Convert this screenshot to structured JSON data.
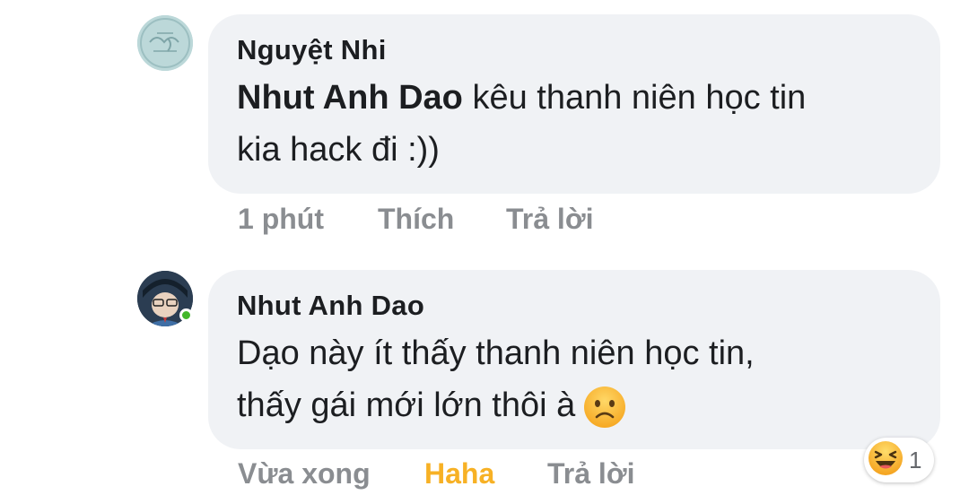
{
  "comments": [
    {
      "author": "Nguyệt Nhi",
      "mention": "Nhut Anh Dao",
      "text_line1": " kêu thanh niên học tin",
      "text_line2": "kia hack đi :))",
      "time": "1 phút",
      "like_label": "Thích",
      "reply_label": "Trả lời"
    },
    {
      "author": "Nhut Anh Dao",
      "text_line1": "Dạo này ít thấy thanh niên học tin,",
      "text_line2": "thấy gái mới lớn thôi à",
      "inline_emoji": "frowning-face",
      "time": "Vừa xong",
      "reaction_label": "Haha",
      "reply_label": "Trả lời",
      "reaction_count": "1",
      "reaction_icon": "haha-laughing-emoji",
      "online": true
    }
  ],
  "colors": {
    "bubble": "#f0f2f5",
    "meta_text": "#8a8d91",
    "haha": "#f7b125",
    "online": "#42b72a"
  }
}
